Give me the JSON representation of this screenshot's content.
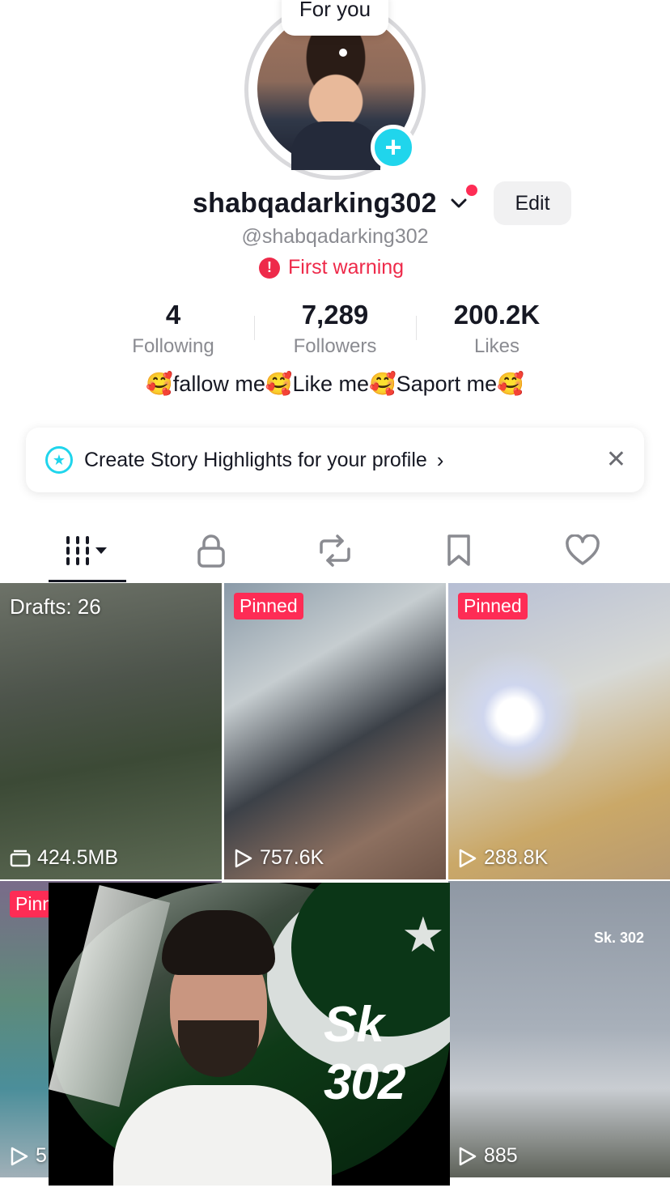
{
  "story_bubble": {
    "label": "For you"
  },
  "profile": {
    "username": "shabqadarking302",
    "handle": "@shabqadarking302",
    "edit_label": "Edit",
    "warning": "First warning",
    "bio": "🥰fallow me🥰Like me🥰Saport me🥰"
  },
  "stats": [
    {
      "value": "4",
      "label": "Following"
    },
    {
      "value": "7,289",
      "label": "Followers"
    },
    {
      "value": "200.2K",
      "label": "Likes"
    }
  ],
  "highlights_banner": {
    "text": "Create Story Highlights for your profile",
    "arrow": "›",
    "close": "✕"
  },
  "tabs": [
    {
      "icon": "videos-grid-icon",
      "active": true
    },
    {
      "icon": "lock-icon"
    },
    {
      "icon": "repost-icon"
    },
    {
      "icon": "bookmark-icon"
    },
    {
      "icon": "heart-icon"
    }
  ],
  "grid": [
    {
      "label": "Drafts: 26",
      "stat": "424.5MB",
      "stat_icon": "drafts-icon"
    },
    {
      "badge": "Pinned",
      "stat": "757.6K",
      "stat_icon": "play-icon"
    },
    {
      "badge": "Pinned",
      "stat": "288.8K",
      "stat_icon": "play-icon"
    },
    {
      "badge": "Pinn",
      "stat": "5",
      "stat_icon": "play-icon"
    },
    {
      "overlay_text": "Sk 302"
    },
    {
      "caption": "Sk. 302",
      "stat": "885",
      "stat_icon": "play-icon"
    }
  ],
  "colors": {
    "accent_red": "#fe2c55",
    "accent_cyan": "#20d5ec",
    "warning_red": "#ee2a4a"
  }
}
